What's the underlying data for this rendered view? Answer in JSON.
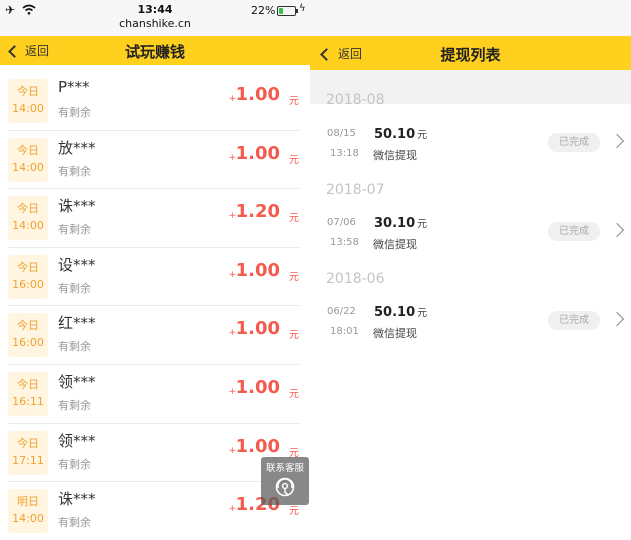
{
  "left": {
    "status_bar": {
      "time": "13:44",
      "url": "chanshike.cn",
      "battery_pct_text": "22%",
      "battery_level": 0.22,
      "icons": [
        "airplane-icon",
        "wifi-icon",
        "battery-icon",
        "charging-icon"
      ]
    },
    "nav": {
      "back_label": "返回",
      "title": "试玩赚钱"
    },
    "rows": [
      {
        "day": "今日",
        "time": "14:00",
        "name": "P***",
        "status": "有剩余",
        "plus": "+",
        "amount": "1.00",
        "unit": "元"
      },
      {
        "day": "今日",
        "time": "14:00",
        "name": "放***",
        "status": "有剩余",
        "plus": "+",
        "amount": "1.00",
        "unit": "元"
      },
      {
        "day": "今日",
        "time": "14:00",
        "name": "诛***",
        "status": "有剩余",
        "plus": "+",
        "amount": "1.20",
        "unit": "元"
      },
      {
        "day": "今日",
        "time": "16:00",
        "name": "设***",
        "status": "有剩余",
        "plus": "+",
        "amount": "1.00",
        "unit": "元"
      },
      {
        "day": "今日",
        "time": "16:00",
        "name": "红***",
        "status": "有剩余",
        "plus": "+",
        "amount": "1.00",
        "unit": "元"
      },
      {
        "day": "今日",
        "time": "16:11",
        "name": "领***",
        "status": "有剩余",
        "plus": "+",
        "amount": "1.00",
        "unit": "元"
      },
      {
        "day": "今日",
        "time": "17:11",
        "name": "领***",
        "status": "有剩余",
        "plus": "+",
        "amount": "1.00",
        "unit": "元"
      },
      {
        "day": "明日",
        "time": "14:00",
        "name": "诛***",
        "status": "有剩余",
        "plus": "+",
        "amount": "1.20",
        "unit": "元"
      }
    ],
    "customer_service": {
      "label": "联系客服",
      "icon": "headset-icon"
    }
  },
  "right": {
    "nav": {
      "back_label": "返回",
      "title": "提现列表"
    },
    "groups": [
      {
        "month": "2018-08",
        "records": [
          {
            "date": "08/15",
            "time": "13:18",
            "amount": "50.10",
            "unit": "元",
            "method": "微信提现",
            "status": "已完成"
          }
        ]
      },
      {
        "month": "2018-07",
        "records": [
          {
            "date": "07/06",
            "time": "13:58",
            "amount": "30.10",
            "unit": "元",
            "method": "微信提现",
            "status": "已完成"
          }
        ]
      },
      {
        "month": "2018-06",
        "records": [
          {
            "date": "06/22",
            "time": "18:01",
            "amount": "50.10",
            "unit": "元",
            "method": "微信提现",
            "status": "已完成"
          }
        ]
      }
    ]
  },
  "colors": {
    "nav_yellow": "#ffd01e",
    "amount_red": "#f55a4e",
    "badge_orange": "#f0a22c",
    "badge_bg": "#fff5e0"
  }
}
